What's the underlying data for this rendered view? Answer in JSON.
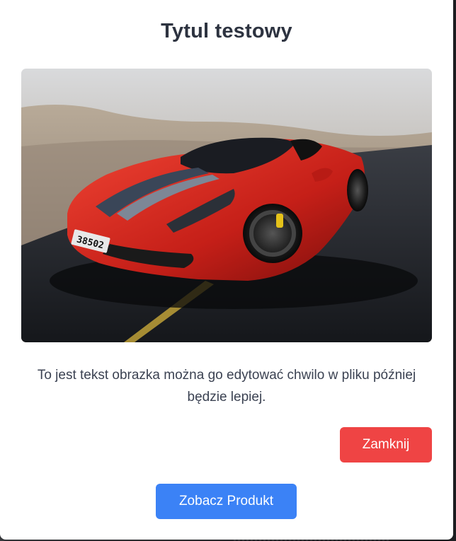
{
  "modal": {
    "title": "Tytul testowy",
    "text": "To jest tekst obrazka można go edytować chwilo w pliku później będzie lepiej.",
    "close_label": "Zamknij",
    "product_label": "Zobacz Produkt",
    "image": {
      "plate_text": "38502"
    }
  },
  "colors": {
    "close_button": "#ef4444",
    "product_button": "#3b82f6",
    "title": "#2d3340"
  }
}
